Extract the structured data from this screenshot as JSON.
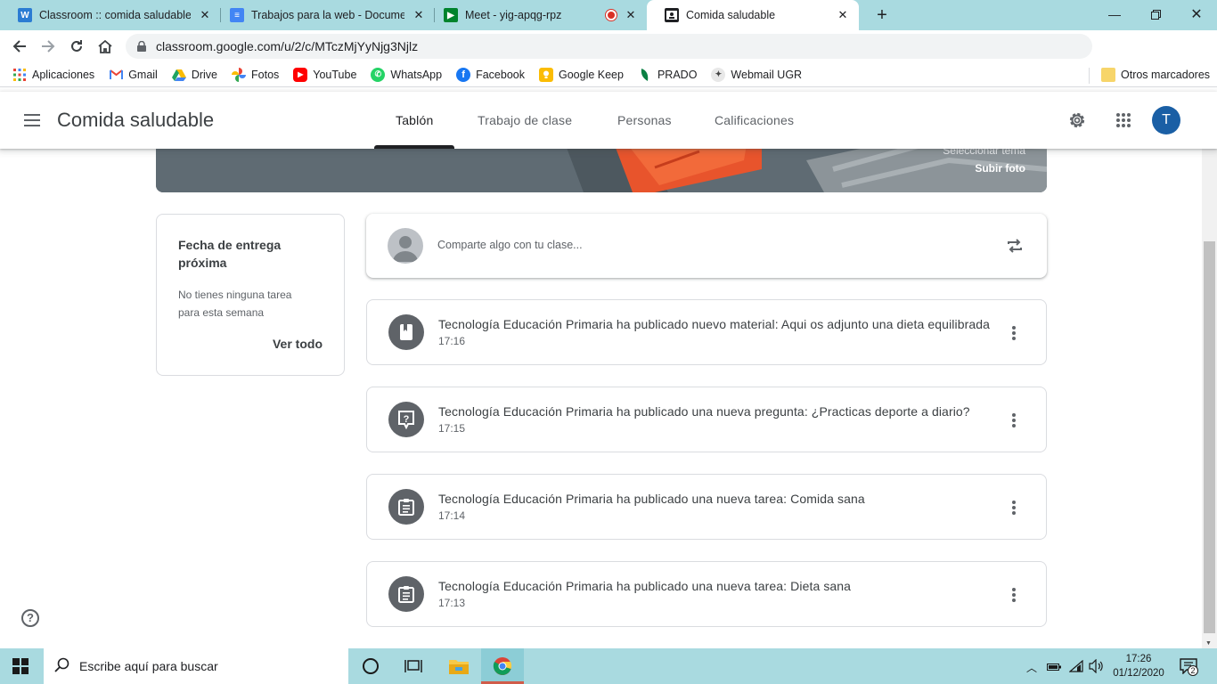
{
  "browser": {
    "tabs": [
      {
        "title": "Classroom :: comida saludable",
        "icon": "word-icon",
        "color": "#2b7cd3"
      },
      {
        "title": "Trabajos para la web - Document",
        "icon": "docs-icon",
        "color": "#4285f4"
      },
      {
        "title": "Meet - yig-apqg-rpz",
        "icon": "meet-icon",
        "color": "#00832d"
      },
      {
        "title": "Comida saludable",
        "icon": "classroom-icon",
        "color": "#202124"
      }
    ],
    "url": "classroom.google.com/u/2/c/MTczMjYyNjg3Njlz",
    "bookmarks": [
      {
        "label": "Aplicaciones",
        "icon": "apps-grid-icon",
        "color": "#5f6368"
      },
      {
        "label": "Gmail",
        "icon": "gmail-icon",
        "color": "#ea4335"
      },
      {
        "label": "Drive",
        "icon": "drive-icon",
        "color": "#1fa463"
      },
      {
        "label": "Fotos",
        "icon": "photos-icon",
        "color": "#fbbc04"
      },
      {
        "label": "YouTube",
        "icon": "youtube-icon",
        "color": "#ff0000"
      },
      {
        "label": "WhatsApp",
        "icon": "whatsapp-icon",
        "color": "#25d366"
      },
      {
        "label": "Facebook",
        "icon": "facebook-icon",
        "color": "#1877f2"
      },
      {
        "label": "Google Keep",
        "icon": "keep-icon",
        "color": "#fbbc04"
      },
      {
        "label": "PRADO",
        "icon": "prado-icon",
        "color": "#0b8043"
      },
      {
        "label": "Webmail UGR",
        "icon": "ugr-icon",
        "color": "#777777"
      }
    ],
    "other_bookmarks": "Otros marcadores"
  },
  "classroom": {
    "class_name": "Comida saludable",
    "tabs": [
      "Tablón",
      "Trabajo de clase",
      "Personas",
      "Calificaciones"
    ],
    "active_tab": "Tablón",
    "avatar_letter": "T",
    "banner": {
      "select_theme": "Seleccionar tema",
      "upload_photo": "Subir foto"
    },
    "upcoming": {
      "title": "Fecha de entrega próxima",
      "empty": "No tienes ninguna tarea para esta semana",
      "view_all": "Ver todo"
    },
    "share_placeholder": "Comparte algo con tu clase...",
    "posts": [
      {
        "text": "Tecnología Educación Primaria ha publicado nuevo material: Aqui os adjunto una dieta equilibrada",
        "time": "17:16",
        "icon": "material-icon"
      },
      {
        "text": "Tecnología Educación Primaria ha publicado una nueva pregunta: ¿Practicas deporte a diario?",
        "time": "17:15",
        "icon": "question-icon"
      },
      {
        "text": "Tecnología Educación Primaria ha publicado una nueva tarea: Comida sana",
        "time": "17:14",
        "icon": "assignment-icon"
      },
      {
        "text": "Tecnología Educación Primaria ha publicado una nueva tarea: Dieta sana",
        "time": "17:13",
        "icon": "assignment-icon"
      }
    ]
  },
  "taskbar": {
    "search_placeholder": "Escribe aquí para buscar",
    "time": "17:26",
    "date": "01/12/2020",
    "notification_count": "2"
  },
  "colors": {
    "accent_avatar": "#1a5fa5",
    "chrome_frame": "#a9dae0",
    "banner": "#5f6b73"
  }
}
